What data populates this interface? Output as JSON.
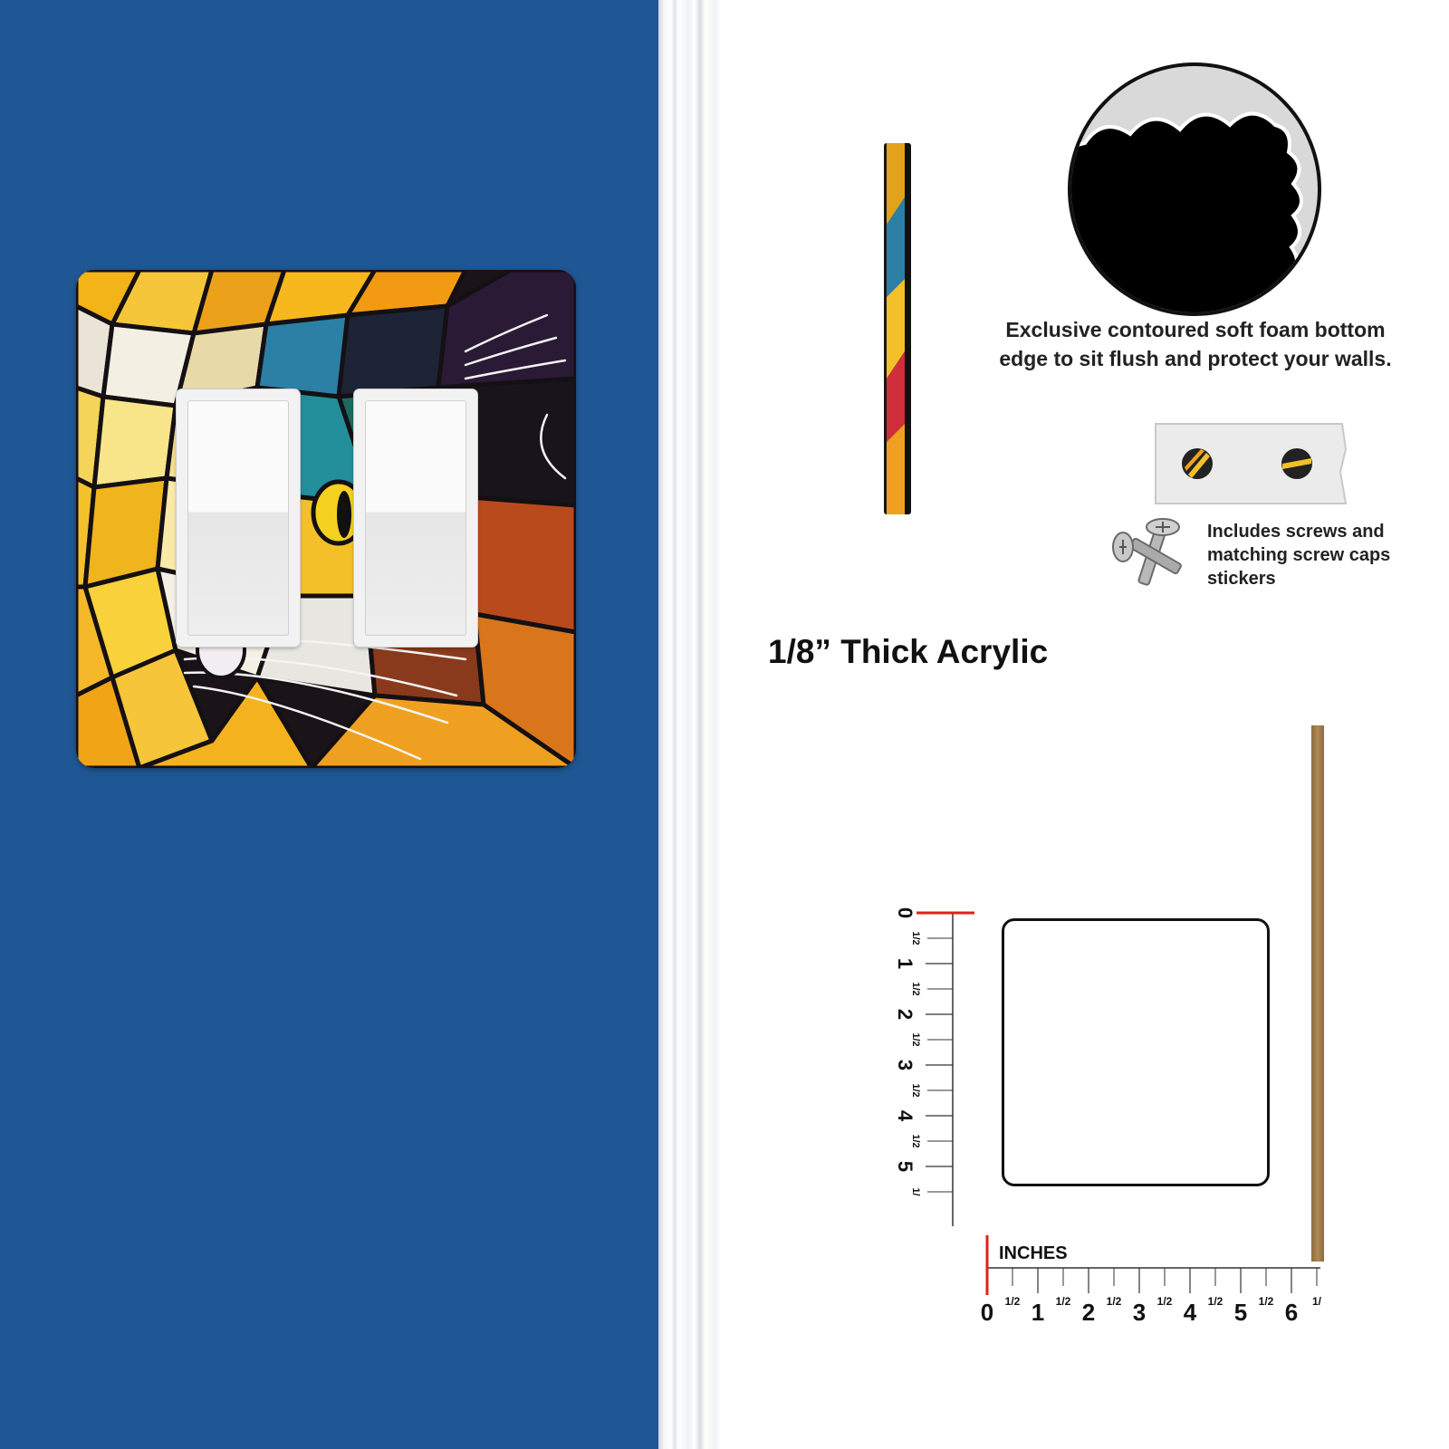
{
  "scene": {
    "wall_color": "#1f5794",
    "switch_count": 2
  },
  "features": {
    "foam_text": "Exclusive contoured soft foam bottom edge to sit flush and protect your walls.",
    "screws_text": "Includes screws and matching screw caps stickers",
    "thickness_label": "1/8” Thick Acrylic"
  },
  "ruler": {
    "unit_label": "INCHES",
    "horizontal_numbers": [
      "0",
      "1",
      "2",
      "3",
      "4",
      "5",
      "6"
    ],
    "horizontal_halves": [
      "1/2",
      "1/2",
      "1/2",
      "1/2",
      "1/2",
      "1/2",
      "1/"
    ],
    "vertical_numbers": [
      "0",
      "1",
      "2",
      "3",
      "4",
      "5"
    ],
    "vertical_halves": [
      "1/2",
      "1/2",
      "1/2",
      "1/2",
      "1/2",
      "1/"
    ]
  }
}
